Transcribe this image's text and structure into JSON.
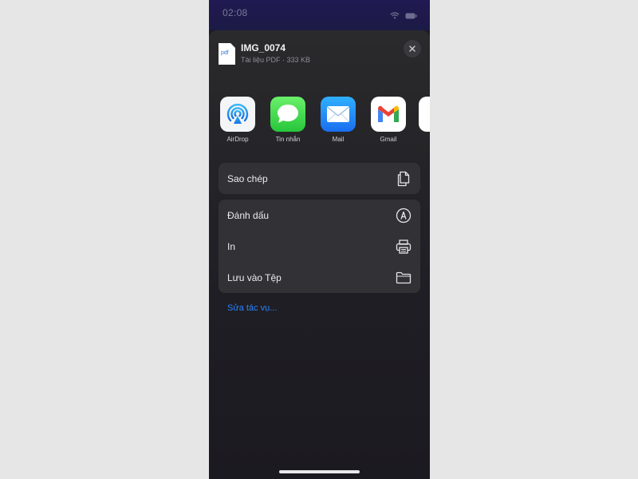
{
  "status_bar": {
    "time": "02:08",
    "icons": [
      "wifi-icon",
      "battery-icon"
    ]
  },
  "share_sheet": {
    "file": {
      "thumbnail_label": "pdf",
      "name": "IMG_0074",
      "meta": "Tài liệu PDF · 333 KB"
    },
    "close_icon": "close-icon",
    "apps": [
      {
        "label": "AirDrop",
        "icon": "airdrop-icon"
      },
      {
        "label": "Tin nhắn",
        "icon": "messages-icon"
      },
      {
        "label": "Mail",
        "icon": "mail-icon"
      },
      {
        "label": "Gmail",
        "icon": "gmail-icon"
      }
    ],
    "actions_primary": [
      {
        "label": "Sao chép",
        "icon": "copy-icon"
      }
    ],
    "actions_secondary": [
      {
        "label": "Đánh dấu",
        "icon": "markup-icon"
      },
      {
        "label": "In",
        "icon": "printer-icon"
      },
      {
        "label": "Lưu vào Tệp",
        "icon": "folder-icon"
      }
    ],
    "edit_actions_label": "Sửa tác vụ..."
  },
  "colors": {
    "sheet_background": "#2a2a2c",
    "row_background": "#323236",
    "link": "#2a84ff",
    "status_bar": "#1f1a52"
  }
}
